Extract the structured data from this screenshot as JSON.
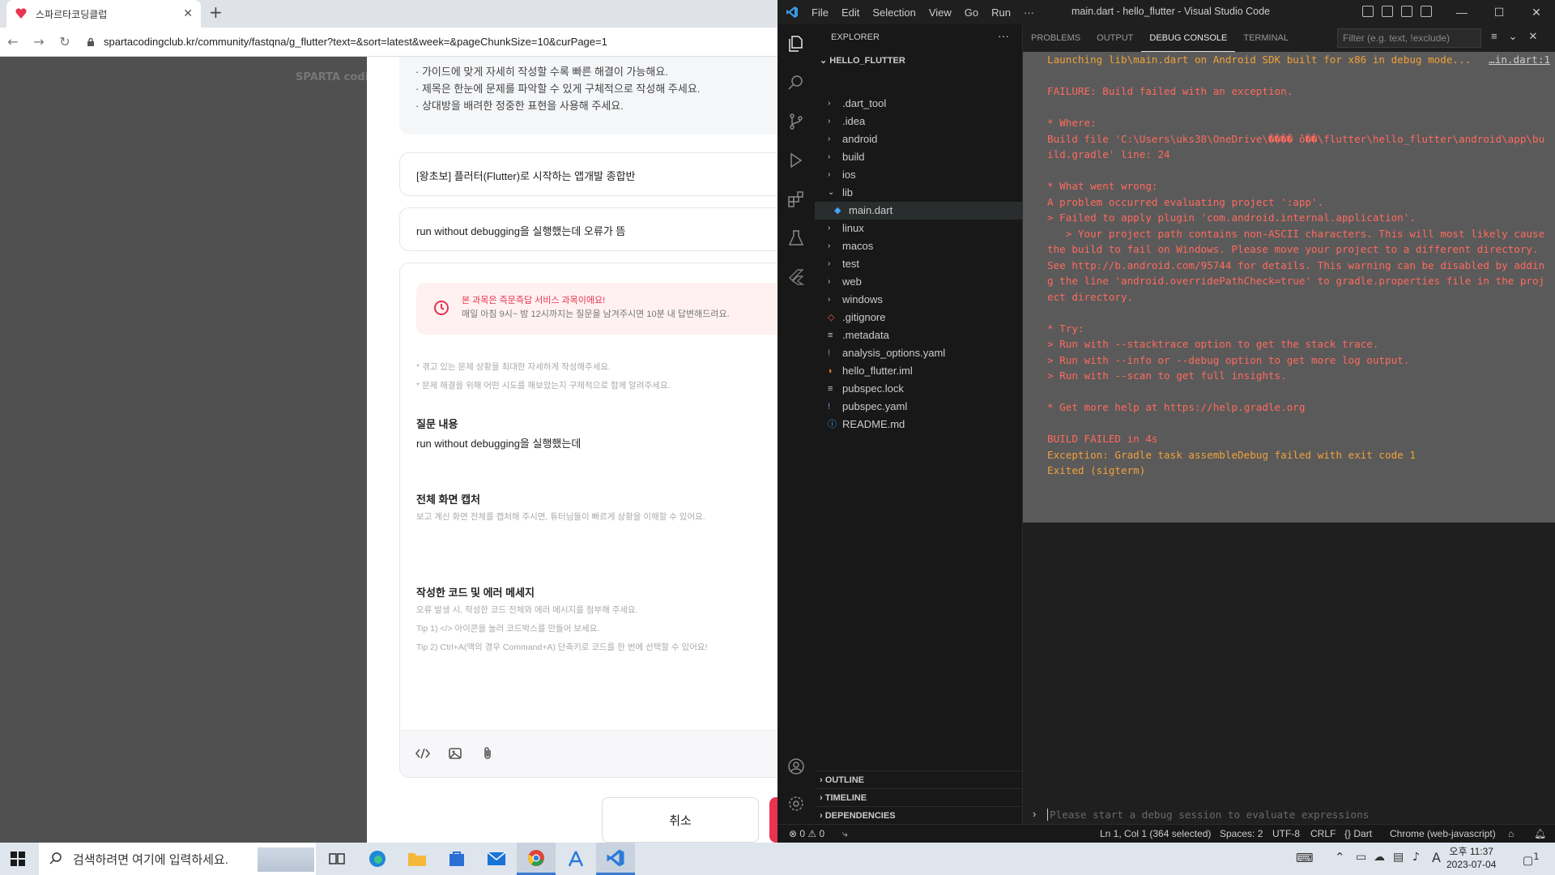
{
  "browser": {
    "tab_title": "스파르타코딩클럽",
    "url": "spartacodingclub.kr/community/fastqna/g_flutter?text=&sort=latest&week=&pageChunkSize=10&curPage=1",
    "logo_text": "SPARTA codingclub"
  },
  "page": {
    "guide": [
      "· 가이드에 맞게 자세히 작성할 수록 빠른 해결이 가능해요.",
      "· 제목은 한눈에 문제를 파악할 수 있게 구체적으로 작성해 주세요.",
      "· 상대방을 배려한 정중한 표현을 사용해 주세요."
    ],
    "course": "[왕초보] 플러터(Flutter)로 시작하는 앱개발 종합반",
    "title": "run without debugging을 실행했는데 오류가 뜸",
    "notice_title": "본 과목은 즉문즉답 서비스 과목이에요!",
    "notice_body": "매일 아침 9시~ 밤 12시까지는 질문을 남겨주시면 10분 내 답변해드려요.",
    "hint1": "* 겪고 있는 문제 상황을 최대한 자세하게 작성해주세요.",
    "hint2": "* 문제 해결을 위해 어떤 시도를 해보았는지 구체적으로 함께 알려주세요.",
    "q_label": "질문 내용",
    "q_body": "run without debugging을 실행했는데",
    "cap_label": "전체 화면 캡처",
    "cap_sub": "보고 계신 화면 전체를 캡처해 주시면, 튜터님들이 빠르게 상황을 이해할 수 있어요.",
    "code_label": "작성한 코드 및 에러 메세지",
    "code_sub1": "오류 발생 시, 작성한 코드 전체와 에러 메시지를 첨부해 주세요.",
    "code_sub2": "Tip 1) </> 아이콘을 눌러 코드박스를 만들어 보세요.",
    "code_sub3": "Tip 2) Ctrl+A(맥의 경우 Command+A) 단축키로 코드를 한 번에 선택할 수 있어요!",
    "cancel": "취소"
  },
  "vscode": {
    "menu": [
      "File",
      "Edit",
      "Selection",
      "View",
      "Go",
      "Run",
      "···"
    ],
    "window_title": "main.dart - hello_flutter - Visual Studio Code",
    "explorer": "EXPLORER",
    "project": "HELLO_FLUTTER",
    "tree": [
      {
        "label": ".dart_tool",
        "kind": "folder",
        "depth": 0
      },
      {
        "label": ".idea",
        "kind": "folder",
        "depth": 0
      },
      {
        "label": "android",
        "kind": "folder",
        "depth": 0
      },
      {
        "label": "build",
        "kind": "folder",
        "depth": 0
      },
      {
        "label": "ios",
        "kind": "folder",
        "depth": 0
      },
      {
        "label": "lib",
        "kind": "folder-open",
        "depth": 0
      },
      {
        "label": "main.dart",
        "kind": "dart",
        "depth": 1,
        "selected": true
      },
      {
        "label": "linux",
        "kind": "folder",
        "depth": 0
      },
      {
        "label": "macos",
        "kind": "folder",
        "depth": 0
      },
      {
        "label": "test",
        "kind": "folder",
        "depth": 0
      },
      {
        "label": "web",
        "kind": "folder",
        "depth": 0
      },
      {
        "label": "windows",
        "kind": "folder",
        "depth": 0
      },
      {
        "label": ".gitignore",
        "kind": "git",
        "depth": 0
      },
      {
        "label": ".metadata",
        "kind": "lines",
        "depth": 0
      },
      {
        "label": "analysis_options.yaml",
        "kind": "yaml",
        "depth": 0
      },
      {
        "label": "hello_flutter.iml",
        "kind": "rss",
        "depth": 0
      },
      {
        "label": "pubspec.lock",
        "kind": "lines",
        "depth": 0
      },
      {
        "label": "pubspec.yaml",
        "kind": "yaml",
        "depth": 0
      },
      {
        "label": "README.md",
        "kind": "info",
        "depth": 0
      }
    ],
    "outline": "OUTLINE",
    "timeline": "TIMELINE",
    "dependencies": "DEPENDENCIES",
    "panel_tabs": [
      "PROBLEMS",
      "OUTPUT",
      "DEBUG CONSOLE",
      "TERMINAL"
    ],
    "filter_placeholder": "Filter (e.g. text, !exclude)",
    "source_link": "…in.dart:1",
    "console_lines": [
      {
        "t": "Launching lib\\main.dart on Android SDK built for x86 in debug mode...",
        "c": "org"
      },
      {
        "t": "",
        "c": "red"
      },
      {
        "t": "FAILURE: Build failed with an exception.",
        "c": "red"
      },
      {
        "t": "",
        "c": "red"
      },
      {
        "t": "* Where:",
        "c": "red"
      },
      {
        "t": "Build file 'C:\\Users\\uks38\\OneDrive\\���� ô��\\flutter\\hello_flutter\\android\\app\\build.gradle' line: 24",
        "c": "red"
      },
      {
        "t": "",
        "c": "red"
      },
      {
        "t": "* What went wrong:",
        "c": "red"
      },
      {
        "t": "A problem occurred evaluating project ':app'.",
        "c": "red"
      },
      {
        "t": "> Failed to apply plugin 'com.android.internal.application'.",
        "c": "red"
      },
      {
        "t": "   > Your project path contains non-ASCII characters. This will most likely cause the build to fail on Windows. Please move your project to a different directory. See http://b.android.com/95744 for details. This warning can be disabled by adding the line 'android.overridePathCheck=true' to gradle.properties file in the project directory.",
        "c": "red"
      },
      {
        "t": "",
        "c": "red"
      },
      {
        "t": "* Try:",
        "c": "red"
      },
      {
        "t": "> Run with --stacktrace option to get the stack trace.",
        "c": "red"
      },
      {
        "t": "> Run with --info or --debug option to get more log output.",
        "c": "red"
      },
      {
        "t": "> Run with --scan to get full insights.",
        "c": "red"
      },
      {
        "t": "",
        "c": "red"
      },
      {
        "t": "* Get more help at https://help.gradle.org",
        "c": "red"
      },
      {
        "t": "",
        "c": "red"
      },
      {
        "t": "BUILD FAILED in 4s",
        "c": "red"
      },
      {
        "t": "Exception: Gradle task assembleDebug failed with exit code 1",
        "c": "org"
      },
      {
        "t": "Exited (sigterm)",
        "c": "org"
      }
    ],
    "eval_placeholder": "Please start a debug session to evaluate expressions",
    "status": {
      "errors": "0",
      "warnings": "0",
      "position": "Ln 1, Col 1 (364 selected)",
      "spaces": "Spaces: 2",
      "encoding": "UTF-8",
      "eol": "CRLF",
      "language": "Dart",
      "device": "Chrome (web-javascript)"
    }
  },
  "taskbar": {
    "search_placeholder": "검색하려면 여기에 입력하세요.",
    "time": "오후 11:37",
    "date": "2023-07-04",
    "notif_count": "1",
    "ime": "A"
  },
  "colors": {
    "error_red": "#ff6a5e",
    "warn_orange": "#f0a13a",
    "brand_red": "#e8344e",
    "vscode_blue": "#3a7bd5"
  }
}
